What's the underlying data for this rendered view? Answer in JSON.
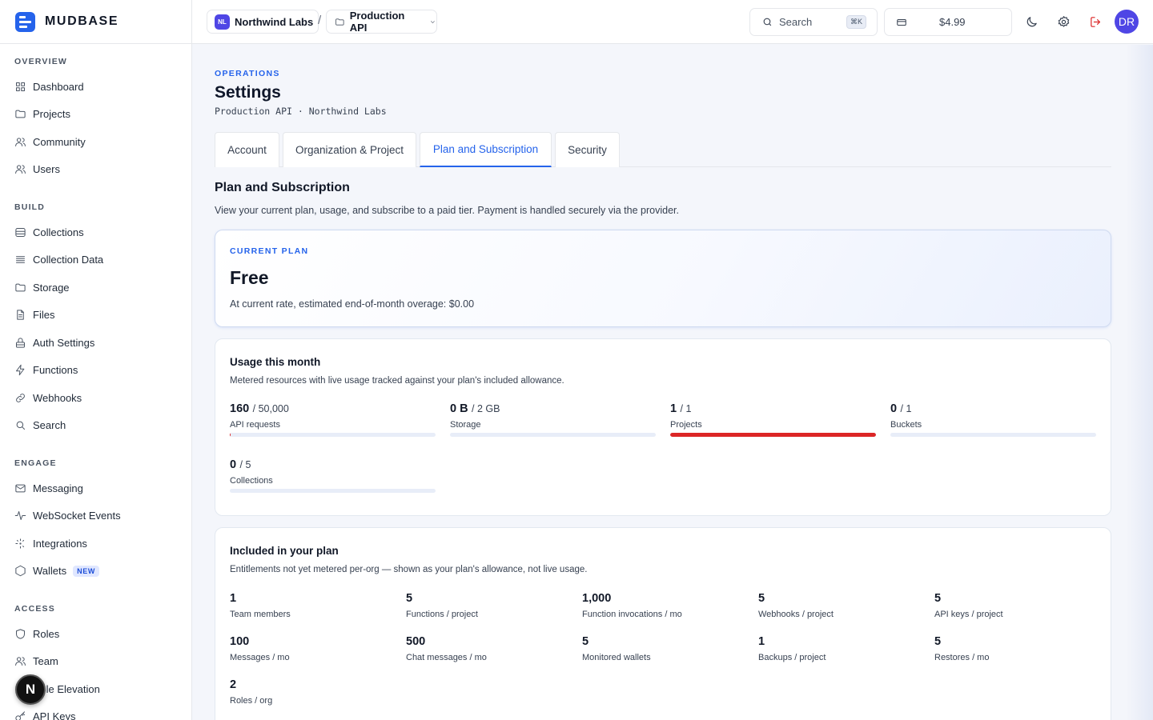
{
  "brand": {
    "name": "MUDBASE"
  },
  "sidebar": {
    "sections": [
      {
        "heading": "OVERVIEW",
        "items": [
          {
            "label": "Dashboard",
            "icon": "grid-icon"
          },
          {
            "label": "Projects",
            "icon": "folder-icon"
          },
          {
            "label": "Community",
            "icon": "users-icon"
          },
          {
            "label": "Users",
            "icon": "users-icon"
          }
        ]
      },
      {
        "heading": "BUILD",
        "items": [
          {
            "label": "Collections",
            "icon": "database-icon"
          },
          {
            "label": "Collection Data",
            "icon": "list-icon"
          },
          {
            "label": "Storage",
            "icon": "folder-icon"
          },
          {
            "label": "Files",
            "icon": "file-icon"
          },
          {
            "label": "Auth Settings",
            "icon": "lock-icon"
          },
          {
            "label": "Functions",
            "icon": "bolt-icon"
          },
          {
            "label": "Webhooks",
            "icon": "link-icon"
          },
          {
            "label": "Search",
            "icon": "search-icon"
          }
        ]
      },
      {
        "heading": "ENGAGE",
        "items": [
          {
            "label": "Messaging",
            "icon": "mail-icon"
          },
          {
            "label": "WebSocket Events",
            "icon": "activity-icon"
          },
          {
            "label": "Integrations",
            "icon": "sparkle-icon"
          },
          {
            "label": "Wallets",
            "icon": "hexagon-icon",
            "badge": "NEW"
          }
        ]
      },
      {
        "heading": "ACCESS",
        "items": [
          {
            "label": "Roles",
            "icon": "shield-icon"
          },
          {
            "label": "Team",
            "icon": "users-icon"
          },
          {
            "label": "Role Elevation",
            "icon": "shield-icon"
          },
          {
            "label": "API Keys",
            "icon": "key-icon"
          }
        ]
      }
    ],
    "fab_label": "N"
  },
  "topbar": {
    "org_initials": "NL",
    "org_name": "Northwind Labs",
    "separator": "/",
    "project_name": "Production API",
    "search_label": "Search",
    "search_shortcut": "⌘K",
    "credit_amount": "$4.99",
    "avatar_initials": "DR"
  },
  "page": {
    "eyebrow": "OPERATIONS",
    "title": "Settings",
    "subtitle": "Production API · Northwind Labs",
    "tabs": [
      {
        "label": "Account",
        "active": false
      },
      {
        "label": "Organization & Project",
        "active": false
      },
      {
        "label": "Plan and Subscription",
        "active": true
      },
      {
        "label": "Security",
        "active": false
      }
    ],
    "section_title": "Plan and Subscription",
    "section_desc": "View your current plan, usage, and subscribe to a paid tier. Payment is handled securely via the provider."
  },
  "plan": {
    "label": "CURRENT PLAN",
    "name": "Free",
    "note": "At current rate, estimated end-of-month overage: $0.00"
  },
  "usage": {
    "title": "Usage this month",
    "desc": "Metered resources with live usage tracked against your plan's included allowance.",
    "meters": [
      {
        "value": "160",
        "limit": "/ 50,000",
        "caption": "API requests",
        "fill": 0.0032
      },
      {
        "value": "0 B",
        "limit": "/ 2 GB",
        "caption": "Storage",
        "fill": 0
      },
      {
        "value": "1",
        "limit": "/ 1",
        "caption": "Projects",
        "fill": 1
      },
      {
        "value": "0",
        "limit": "/ 1",
        "caption": "Buckets",
        "fill": 0
      },
      {
        "value": "0",
        "limit": "/ 5",
        "caption": "Collections",
        "fill": 0
      }
    ],
    "colors": {
      "track": "#e8edf8",
      "full": "#dc2626"
    }
  },
  "included": {
    "title": "Included in your plan",
    "desc": "Entitlements not yet metered per-org — shown as your plan's allowance, not live usage.",
    "items": [
      {
        "value": "1",
        "caption": "Team members"
      },
      {
        "value": "5",
        "caption": "Functions / project"
      },
      {
        "value": "1,000",
        "caption": "Function invocations / mo"
      },
      {
        "value": "5",
        "caption": "Webhooks / project"
      },
      {
        "value": "5",
        "caption": "API keys / project"
      },
      {
        "value": "100",
        "caption": "Messages / mo"
      },
      {
        "value": "500",
        "caption": "Chat messages / mo"
      },
      {
        "value": "5",
        "caption": "Monitored wallets"
      },
      {
        "value": "1",
        "caption": "Backups / project"
      },
      {
        "value": "5",
        "caption": "Restores / mo"
      },
      {
        "value": "2",
        "caption": "Roles / org"
      }
    ]
  },
  "colors": {
    "accent": "#2563eb",
    "danger": "#dc2626",
    "logout": "#dc2626"
  }
}
